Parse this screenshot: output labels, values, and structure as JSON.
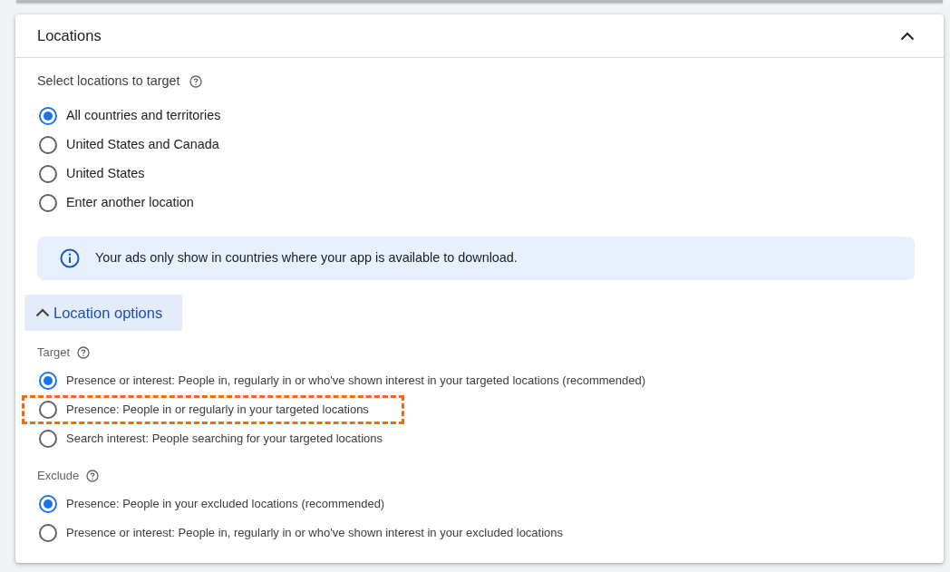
{
  "section": {
    "title": "Locations",
    "expanded": true
  },
  "location_targeting": {
    "label": "Select locations to target",
    "options": [
      {
        "label": "All countries and territories",
        "selected": true
      },
      {
        "label": "United States and Canada",
        "selected": false
      },
      {
        "label": "United States",
        "selected": false
      },
      {
        "label": "Enter another location",
        "selected": false
      }
    ]
  },
  "info_banner": {
    "text": "Your ads only show in countries where your app is available to download."
  },
  "location_options": {
    "label": "Location options",
    "expanded": true,
    "target": {
      "label": "Target",
      "options": [
        {
          "label": "Presence or interest: People in, regularly in or who've shown interest in your targeted locations (recommended)",
          "selected": true,
          "highlighted": false
        },
        {
          "label": "Presence: People in or regularly in your targeted locations",
          "selected": false,
          "highlighted": true
        },
        {
          "label": "Search interest: People searching for your targeted locations",
          "selected": false,
          "highlighted": false
        }
      ]
    },
    "exclude": {
      "label": "Exclude",
      "options": [
        {
          "label": "Presence: People in your excluded locations (recommended)",
          "selected": true
        },
        {
          "label": "Presence or interest: People in, regularly in or who've shown interest in your excluded locations",
          "selected": false
        }
      ]
    }
  }
}
